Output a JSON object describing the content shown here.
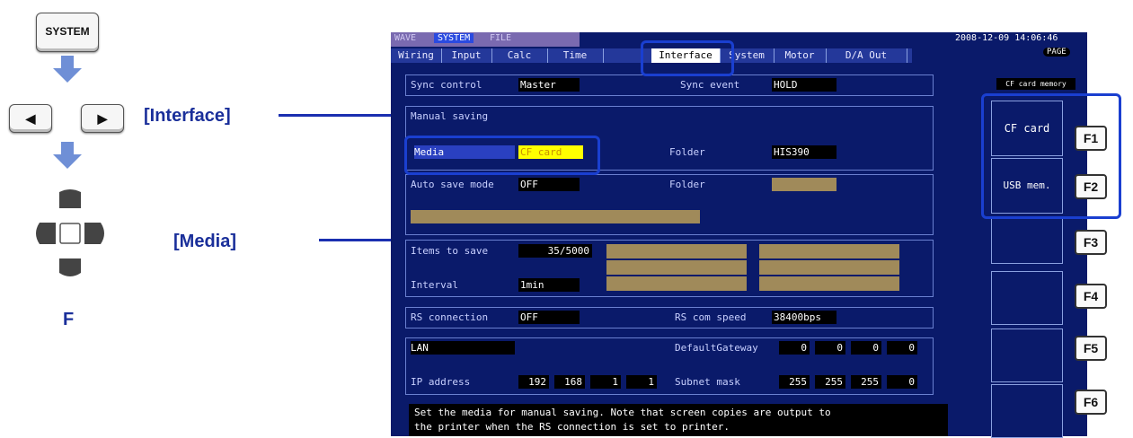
{
  "guide": {
    "system_key": "SYSTEM",
    "interface_label": "[Interface]",
    "media_label": "[Media]",
    "f_label": "F"
  },
  "screen": {
    "mode_tabs": [
      "WAVE",
      "SYSTEM",
      "FILE"
    ],
    "datetime": "2008-12-09 14:06:46",
    "page_badge": "PAGE",
    "tabs": [
      "Wiring",
      "Input",
      "Calc",
      "Time",
      "Interface",
      "System",
      "Motor",
      "D/A Out"
    ],
    "active_tab": "Interface",
    "sync_control_label": "Sync control",
    "sync_control_value": "Master",
    "sync_event_label": "Sync event",
    "sync_event_value": "HOLD",
    "manual_saving_label": "Manual saving",
    "media_label": "Media",
    "media_value": "CF card",
    "folder1_label": "Folder",
    "folder1_value": "HIS390",
    "auto_save_label": "Auto save mode",
    "auto_save_value": "OFF",
    "folder2_label": "Folder",
    "items_to_save_label": "Items to save",
    "items_to_save_value": "35/5000",
    "interval_label": "Interval",
    "interval_value": "1min",
    "rs_connection_label": "RS connection",
    "rs_connection_value": "OFF",
    "rs_speed_label": "RS com speed",
    "rs_speed_value": "38400bps",
    "lan_label": "LAN",
    "gateway_label": "DefaultGateway",
    "gateway": [
      "0",
      "0",
      "0",
      "0"
    ],
    "ip_label": "IP address",
    "ip": [
      "192",
      "168",
      "1",
      "1"
    ],
    "subnet_label": "Subnet mask",
    "subnet": [
      "255",
      "255",
      "255",
      "0"
    ],
    "help_line1": "Set the media for manual saving. Note that screen copies are output to",
    "help_line2": "the printer when the RS connection is set to printer.",
    "side_header": "CF card memory",
    "fbtn1": "CF card",
    "fbtn2": "USB mem."
  },
  "fkeys": [
    "F1",
    "F2",
    "F3",
    "F4",
    "F5",
    "F6"
  ],
  "colors": {
    "screen_bg": "#0a1a6a",
    "highlight": "#1a3fd0",
    "media_value_bg": "#ffff00",
    "arrow": "#6f8fd6"
  }
}
